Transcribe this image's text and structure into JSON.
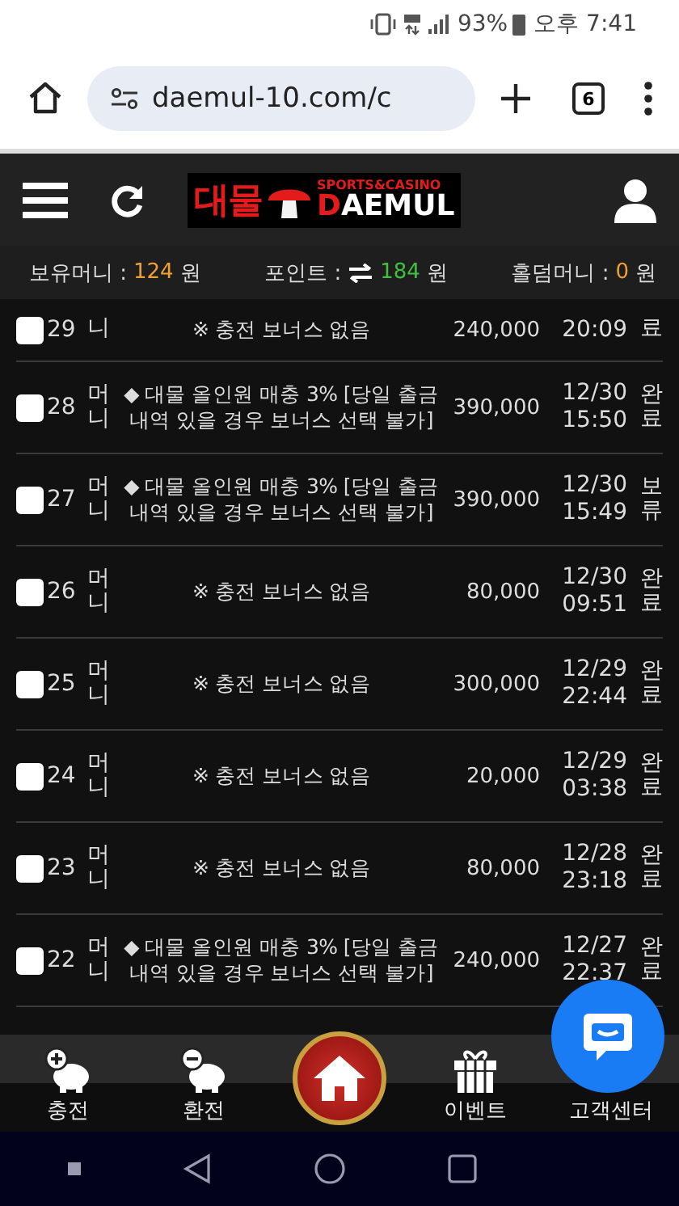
{
  "status_bar": {
    "battery": "93%",
    "time": "오후 7:41"
  },
  "browser": {
    "url": "daemul-10.com/c",
    "tab_count": "6"
  },
  "header": {
    "logo_korean": "대물",
    "logo_tagline": "SPORTS&CASINO",
    "logo_name": "DAEMUL"
  },
  "balances": [
    {
      "label": "보유머니 :",
      "value": "124",
      "unit": "원",
      "color": "#f0a030"
    },
    {
      "label": "포인트 :",
      "value": "184",
      "unit": "원",
      "color": "#40c040"
    },
    {
      "label": "홀덤머니 :",
      "value": "0",
      "unit": "원",
      "color": "#f0a030"
    }
  ],
  "rows": [
    {
      "number": "29",
      "type": "니",
      "description": "※ 충전 보너스 없음",
      "amount": "240,000",
      "time": "20:09",
      "status": "료",
      "checked": false
    },
    {
      "number": "28",
      "type": "머니",
      "description": "◆ 대물 올인원 매충 3% [당일 출금 내역 있을 경우 보너스 선택 불가]",
      "amount": "390,000",
      "date": "12/30",
      "time": "15:50",
      "status": "완료",
      "checked": false
    },
    {
      "number": "27",
      "type": "머니",
      "description": "◆ 대물 올인원 매충 3% [당일 출금 내역 있을 경우 보너스 선택 불가]",
      "amount": "390,000",
      "date": "12/30",
      "time": "15:49",
      "status": "보류",
      "checked": false
    },
    {
      "number": "26",
      "type": "머니",
      "description": "※ 충전 보너스 없음",
      "amount": "80,000",
      "date": "12/30",
      "time": "09:51",
      "status": "완료",
      "checked": false
    },
    {
      "number": "25",
      "type": "머니",
      "description": "※ 충전 보너스 없음",
      "amount": "300,000",
      "date": "12/29",
      "time": "22:44",
      "status": "완료",
      "checked": false
    },
    {
      "number": "24",
      "type": "머니",
      "description": "※ 충전 보너스 없음",
      "amount": "20,000",
      "date": "12/29",
      "time": "03:38",
      "status": "완료",
      "checked": false
    },
    {
      "number": "23",
      "type": "머니",
      "description": "※ 충전 보너스 없음",
      "amount": "80,000",
      "date": "12/28",
      "time": "23:18",
      "status": "완료",
      "checked": false
    },
    {
      "number": "22",
      "type": "머니",
      "description": "◆ 대물 올인원 매충 3% [당일 출금 내역 있을 경우 보너스 선택 불가]",
      "amount": "240,000",
      "date": "12/27",
      "time": "22:37",
      "status": "완료",
      "checked": false
    }
  ],
  "bottom_nav": [
    {
      "kind": "deposit",
      "label": "충전"
    },
    {
      "kind": "withdraw",
      "label": "환전"
    },
    {
      "kind": "home"
    },
    {
      "kind": "event",
      "label": "이벤트"
    },
    {
      "kind": "support",
      "label": "고객센터"
    }
  ]
}
